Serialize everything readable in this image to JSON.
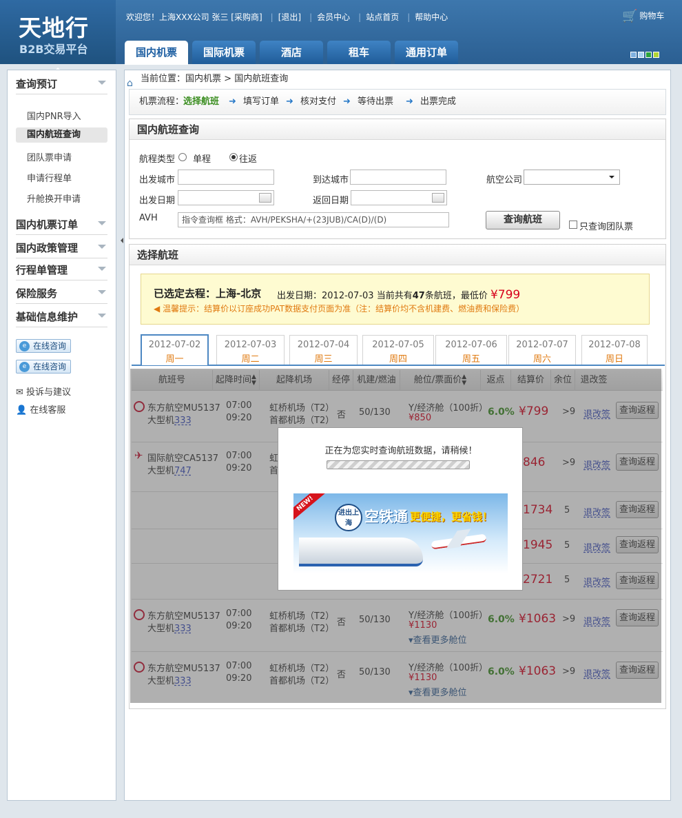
{
  "header": {
    "logo_main": "天地行",
    "logo_sub": "B2B交易平台",
    "welcome": "欢迎您！上海XXX公司  张三  [采购商]",
    "links": [
      "[退出]",
      "会员中心",
      "站点首页",
      "帮助中心"
    ],
    "cart": "购物车",
    "tabs": [
      "国内机票",
      "国际机票",
      "酒店",
      "租车",
      "通用订单"
    ],
    "skin_colors": [
      "#7fb1e0",
      "#a9d2f2",
      "#2aa43b",
      "#b2d435"
    ]
  },
  "sidebar": {
    "groups": [
      {
        "title": "查询预订",
        "items": [
          "国内PNR导入",
          "国内航班查询",
          "团队票申请",
          "申请行程单",
          "升舱换开申请"
        ],
        "active": "国内航班查询"
      },
      {
        "title": "国内机票订单"
      },
      {
        "title": "国内政策管理"
      },
      {
        "title": "行程单管理"
      },
      {
        "title": "保险服务"
      },
      {
        "title": "基础信息维护"
      }
    ],
    "chat_buttons": [
      "在线咨询",
      "在线咨询"
    ],
    "links": [
      "投诉与建议",
      "在线客服"
    ]
  },
  "breadcrumb": {
    "label": "当前位置：",
    "items": [
      "国内机票",
      "国内航班查询"
    ],
    "sep": ">"
  },
  "flow": {
    "label": "机票流程：",
    "steps": [
      "选择航班",
      "填写订单",
      "核对支付",
      "等待出票",
      "出票完成"
    ],
    "current": "选择航班"
  },
  "search": {
    "title": "国内航班查询",
    "trip_type_label": "航程类型",
    "trip_types": [
      "单程",
      "往返"
    ],
    "trip_selected": "往返",
    "from_label": "出发城市",
    "to_label": "到达城市",
    "airline_label": "航空公司",
    "depart_label": "出发日期",
    "return_label": "返回日期",
    "avh_label": "AVH",
    "avh_placeholder": "指令查询框 格式：AVH/PEKSHA/+(23JUB)/CA(D)/(D)",
    "search_button": "查询航班",
    "group_only": "只查询团队票"
  },
  "results": {
    "title": "选择航班",
    "route_label": "已选定去程：",
    "route": "上海-北京",
    "date_label": "出发日期：",
    "date": "2012-07-03",
    "count_pre": "当前共有",
    "count": "47",
    "count_post": "条航班，最低价",
    "lowest_price": "¥799",
    "tip": "温馨提示：结算价以订座成功PAT数据支付页面为准（注：结算价均不含机建费、燃油费和保险费）",
    "date_tabs": [
      {
        "date": "2012-07-02",
        "weekday": "周一"
      },
      {
        "date": "2012-07-03",
        "weekday": "周二"
      },
      {
        "date": "2012-07-04",
        "weekday": "周三"
      },
      {
        "date": "2012-07-05",
        "weekday": "周四"
      },
      {
        "date": "2012-07-06",
        "weekday": "周五"
      },
      {
        "date": "2012-07-07",
        "weekday": "周六"
      },
      {
        "date": "2012-07-08",
        "weekday": "周日"
      }
    ],
    "active_tab": 0,
    "columns": [
      "航班号",
      "起降时间",
      "起降机场",
      "经停",
      "机建/燃油",
      "舱位/票面价",
      "返点",
      "结算价",
      "余位",
      "退改签"
    ],
    "rows": [
      {
        "airline": "东方航空MU5137",
        "plane_pre": "大型机",
        "plane_type": "333",
        "dep": "07:00",
        "arr": "09:20",
        "dep_airport": "虹桥机场（T2）",
        "arr_airport": "首都机场（T2）",
        "stop": "否",
        "tax": "50/130",
        "cabin": "Y/经济舱（100折）",
        "face": "¥850",
        "rate": "6.0%",
        "price": "¥799",
        "seats": ">9",
        "rule": "退改签",
        "action": "查询返程"
      },
      {
        "airline": "国际航空CA5137",
        "plane_pre": "大型机",
        "plane_type": "747",
        "dep": "07:00",
        "arr": "09:20",
        "dep_airport": "虹",
        "arr_airport": "首",
        "stop": "",
        "tax": "",
        "cabin": "",
        "face": "",
        "rate": "",
        "price": "846",
        "seats": ">9",
        "rule": "退改签",
        "action": "查询返程"
      },
      {
        "airline": "",
        "plane_pre": "",
        "plane_type": "",
        "dep": "",
        "arr": "",
        "dep_airport": "",
        "arr_airport": "",
        "stop": "",
        "tax": "",
        "cabin": "",
        "face": "",
        "rate": "",
        "price": "1734",
        "seats": "5",
        "rule": "退改签",
        "action": "查询返程"
      },
      {
        "airline": "",
        "plane_pre": "",
        "plane_type": "",
        "dep": "",
        "arr": "",
        "dep_airport": "",
        "arr_airport": "",
        "stop": "",
        "tax": "",
        "cabin": "",
        "face": "",
        "rate": "",
        "price": "1945",
        "seats": "5",
        "rule": "退改签",
        "action": "查询返程"
      },
      {
        "airline": "",
        "plane_pre": "",
        "plane_type": "",
        "dep": "",
        "arr": "",
        "dep_airport": "",
        "arr_airport": "",
        "stop": "",
        "tax": "",
        "cabin": "",
        "face": "",
        "rate": "",
        "price": "2721",
        "seats": "5",
        "rule": "退改签",
        "action": "查询返程"
      },
      {
        "airline": "东方航空MU5137",
        "plane_pre": "大型机",
        "plane_type": "333",
        "dep": "07:00",
        "arr": "09:20",
        "dep_airport": "虹桥机场（T2）",
        "arr_airport": "首都机场（T2）",
        "stop": "否",
        "tax": "50/130",
        "cabin": "Y/经济舱（100折）",
        "face": "¥1130",
        "more": "查看更多舱位",
        "rate": "6.0%",
        "price": "¥1063",
        "seats": ">9",
        "rule": "退改签",
        "action": "查询返程"
      },
      {
        "airline": "东方航空MU5137",
        "plane_pre": "大型机",
        "plane_type": "333",
        "dep": "07:00",
        "arr": "09:20",
        "dep_airport": "虹桥机场（T2）",
        "arr_airport": "首都机场（T2）",
        "stop": "否",
        "tax": "50/130",
        "cabin": "Y/经济舱（100折）",
        "face": "¥1130",
        "more": "查看更多舱位",
        "rate": "6.0%",
        "price": "¥1063",
        "seats": ">9",
        "rule": "退改签",
        "action": "查询返程"
      }
    ]
  },
  "loading": {
    "message": "正在为您实时查询航班数据，请稍候！",
    "banner_new": "NEW!",
    "banner_badge": "进出上海",
    "banner_slogan1": "空铁通",
    "banner_slogan2": "更便捷，更省钱！"
  }
}
